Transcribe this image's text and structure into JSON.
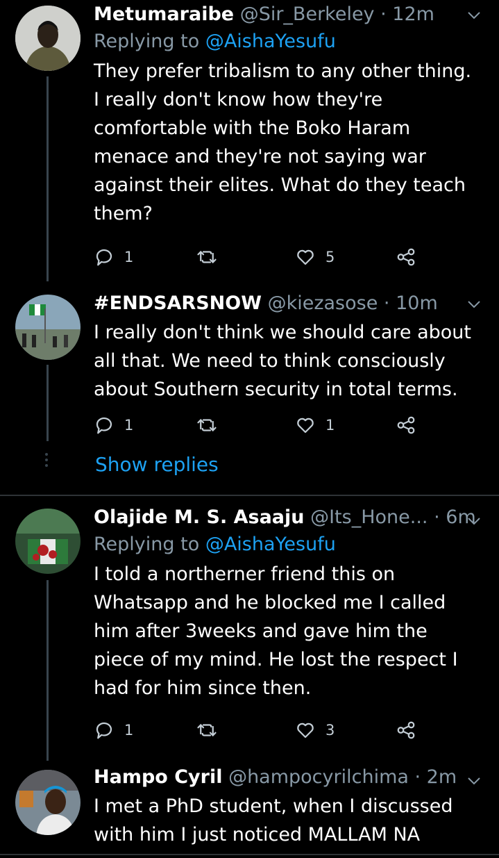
{
  "tweets": [
    {
      "name": "Metumaraibe",
      "handle": "@Sir_Berkeley",
      "time": "· 12m",
      "replying_prefix": "Replying to",
      "replying_to": "@AishaYesufu",
      "text": "They prefer tribalism to any other thing. I really don't know how they're comfortable with the Boko Haram menace and they're not saying war against their elites. What do they teach them?",
      "replies": "1",
      "retweets": "",
      "likes": "5"
    },
    {
      "name": "#ENDSARSNOW",
      "handle": "@kiezasose",
      "time": "· 10m",
      "text": "I really don't think we should care about all that. We need to think consciously about Southern security in total terms.",
      "replies": "1",
      "retweets": "",
      "likes": "1"
    },
    {
      "name": "Olajide M. S. Asaaju",
      "handle": "@Its_Hone...",
      "time": "· 6m",
      "replying_prefix": "Replying to",
      "replying_to": "@AishaYesufu",
      "text": "I told a northerner friend this on Whatsapp and he blocked me I called him after 3weeks and gave him the piece of my mind. He lost the respect I had for him since then.",
      "replies": "1",
      "retweets": "",
      "likes": "3"
    },
    {
      "name": "Hampo Cyril",
      "handle": "@hampocyrilchima",
      "time": "· 2m",
      "text": "I met a PhD student, when I discussed with him I just noticed MALLAM NA"
    }
  ],
  "show_replies": "Show replies",
  "icons": [
    "reply-icon",
    "retweet-icon",
    "like-icon",
    "share-icon",
    "chevron-down-icon"
  ],
  "colors": {
    "background": "#000000",
    "accent": "#1da1f2",
    "muted": "#8899a6"
  }
}
